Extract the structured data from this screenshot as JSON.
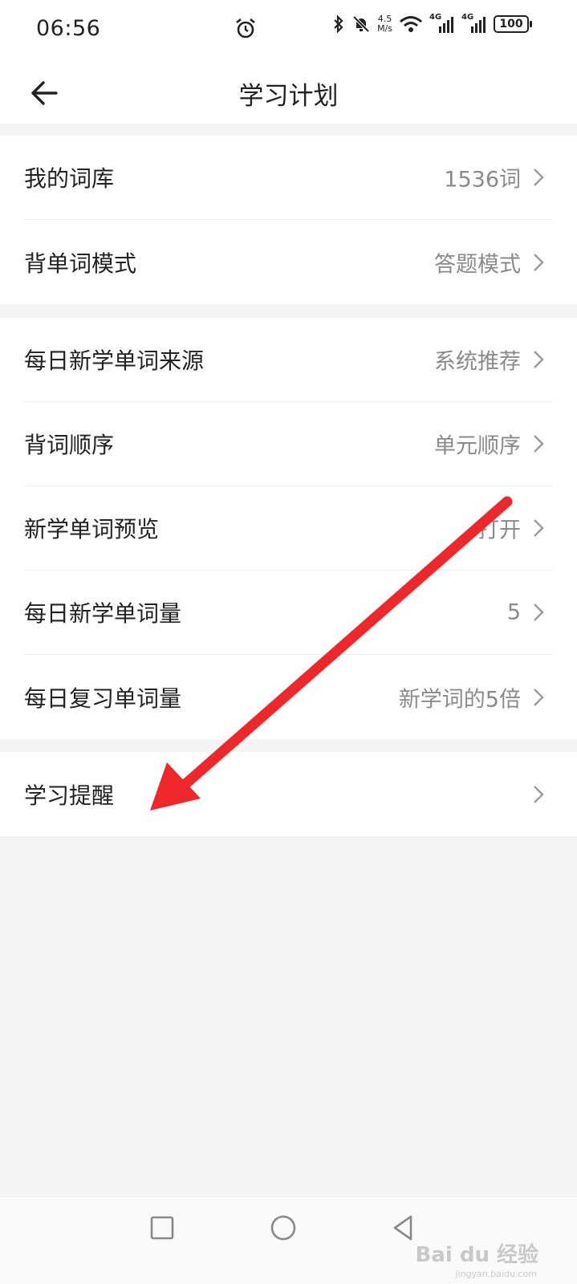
{
  "status_bar": {
    "time": "06:56",
    "net_speed_top": "4.5",
    "net_speed_bottom": "M/s",
    "sim1": "4G",
    "sim2": "4G",
    "battery": "100"
  },
  "header": {
    "title": "学习计划"
  },
  "groups": [
    {
      "items": [
        {
          "label": "我的词库",
          "value": "1536词"
        },
        {
          "label": "背单词模式",
          "value": "答题模式"
        }
      ]
    },
    {
      "items": [
        {
          "label": "每日新学单词来源",
          "value": "系统推荐"
        },
        {
          "label": "背词顺序",
          "value": "单元顺序"
        },
        {
          "label": "新学单词预览",
          "value": "打开"
        },
        {
          "label": "每日新学单词量",
          "value": "5"
        },
        {
          "label": "每日复习单词量",
          "value": "新学词的5倍"
        }
      ]
    },
    {
      "items": [
        {
          "label": "学习提醒",
          "value": ""
        }
      ]
    }
  ],
  "annotation": {
    "color": "#f0272a"
  },
  "watermark": {
    "text": "Bai du 经验",
    "sub": "jingyan.baidu.com"
  },
  "colors": {
    "background": "#f4f4f4",
    "card": "#ffffff",
    "value_text": "#8a8a8a",
    "chevron": "#9a9a9a"
  }
}
